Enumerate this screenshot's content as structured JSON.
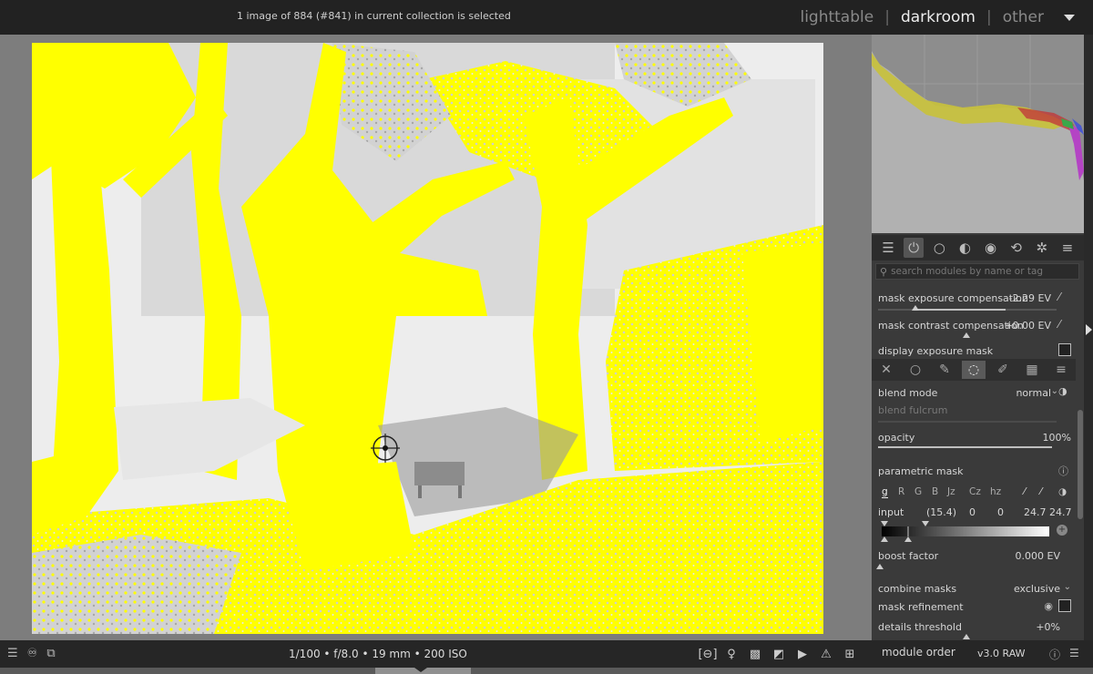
{
  "header": {
    "status": "1 image of 884 (#841) in current collection is selected",
    "views": [
      {
        "label": "lighttable",
        "active": false
      },
      {
        "label": "darkroom",
        "active": true
      },
      {
        "label": "other",
        "active": false
      }
    ],
    "separator": "|"
  },
  "search": {
    "placeholder": "search modules by name or tag"
  },
  "mask_exposure": {
    "label": "mask exposure compensation",
    "value": "-2.29 EV"
  },
  "mask_contrast": {
    "label": "mask contrast compensation",
    "value": "+0.00 EV"
  },
  "display_exposure_mask": {
    "label": "display exposure mask"
  },
  "blend_mode": {
    "label": "blend mode",
    "value": "normal"
  },
  "blend_fulcrum": {
    "label": "blend fulcrum"
  },
  "opacity": {
    "label": "opacity",
    "value": "100%",
    "fraction": 1.0
  },
  "parametric_mask": {
    "label": "parametric mask"
  },
  "channels": [
    "g",
    "R",
    "G",
    "B",
    "Jz",
    "Cz",
    "hz"
  ],
  "input_row": {
    "label": "input",
    "values": [
      "(15.4)",
      "0",
      "0",
      "24.7",
      "24.7"
    ]
  },
  "boost_factor": {
    "label": "boost factor",
    "value": "0.000 EV"
  },
  "combine_masks": {
    "label": "combine masks",
    "value": "exclusive"
  },
  "mask_refinement": {
    "label": "mask refinement"
  },
  "details_threshold": {
    "label": "details threshold",
    "value": "+0%"
  },
  "bottom": {
    "exif": "1/100 • f/8.0 • 19 mm • 200 ISO",
    "module_order_label": "module order",
    "version": "v3.0 RAW"
  },
  "colors": {
    "mask_overlay": "#ffff00",
    "panel_bg": "#3a3a3a"
  }
}
